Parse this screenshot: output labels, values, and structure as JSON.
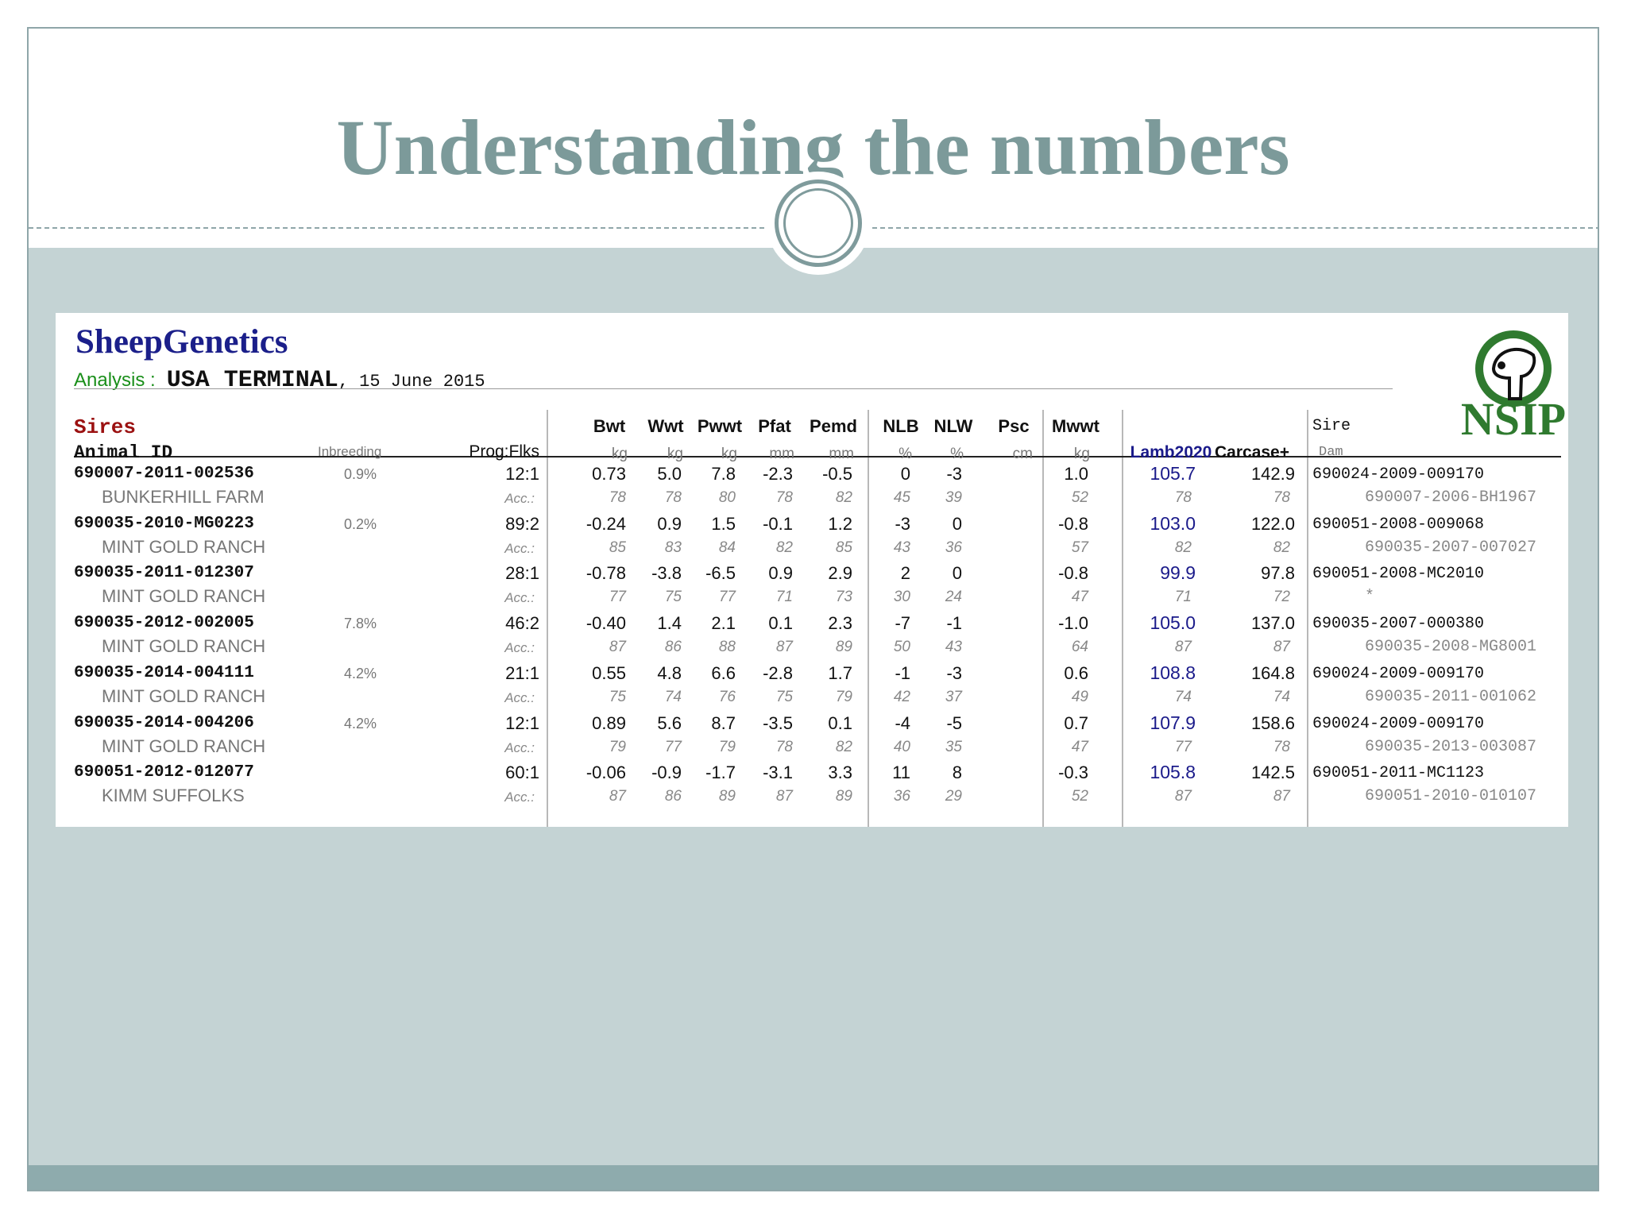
{
  "slide": {
    "title": "Understanding the numbers"
  },
  "report": {
    "brand": "SheepGenetics",
    "analysis_label": "Analysis :",
    "analysis_name": "USA TERMINAL",
    "analysis_date": ", 15 June 2015",
    "logo_text": "NSIP",
    "section_label": "Sires",
    "col_animal": "Animal ID",
    "col_inbreeding": "Inbreeding",
    "col_prog": "Prog:Flks",
    "traits": [
      {
        "name": "Bwt",
        "unit": "kg"
      },
      {
        "name": "Wwt",
        "unit": "kg"
      },
      {
        "name": "Pwwt",
        "unit": "kg"
      },
      {
        "name": "Pfat",
        "unit": "mm"
      },
      {
        "name": "Pemd",
        "unit": "mm"
      },
      {
        "name": "NLB",
        "unit": "%"
      },
      {
        "name": "NLW",
        "unit": "%"
      },
      {
        "name": "Psc",
        "unit": "cm"
      },
      {
        "name": "Mwwt",
        "unit": "kg"
      }
    ],
    "col_lamb": "Lamb2020",
    "col_carcase": "Carcase+",
    "col_sire": "Sire",
    "col_dam": "Dam",
    "acc_label": "Acc.:",
    "rows": [
      {
        "id": "690007-2011-002536",
        "farm": "BUNKERHILL FARM",
        "inbreeding": "0.9%",
        "prog": "12:1",
        "values": [
          "0.73",
          "5.0",
          "7.8",
          "-2.3",
          "-0.5",
          "0",
          "-3",
          "",
          "1.0"
        ],
        "acc": [
          "78",
          "78",
          "80",
          "78",
          "82",
          "45",
          "39",
          "",
          "52"
        ],
        "lamb": "105.7",
        "carcase": "142.9",
        "lamb_acc": "78",
        "carcase_acc": "78",
        "sire": "690024-2009-009170",
        "dam": "690007-2006-BH1967"
      },
      {
        "id": "690035-2010-MG0223",
        "farm": "MINT GOLD RANCH",
        "inbreeding": "0.2%",
        "prog": "89:2",
        "values": [
          "-0.24",
          "0.9",
          "1.5",
          "-0.1",
          "1.2",
          "-3",
          "0",
          "",
          "-0.8"
        ],
        "acc": [
          "85",
          "83",
          "84",
          "82",
          "85",
          "43",
          "36",
          "",
          "57"
        ],
        "lamb": "103.0",
        "carcase": "122.0",
        "lamb_acc": "82",
        "carcase_acc": "82",
        "sire": "690051-2008-009068",
        "dam": "690035-2007-007027"
      },
      {
        "id": "690035-2011-012307",
        "farm": "MINT GOLD RANCH",
        "inbreeding": "",
        "prog": "28:1",
        "values": [
          "-0.78",
          "-3.8",
          "-6.5",
          "0.9",
          "2.9",
          "2",
          "0",
          "",
          "-0.8"
        ],
        "acc": [
          "77",
          "75",
          "77",
          "71",
          "73",
          "30",
          "24",
          "",
          "47"
        ],
        "lamb": "99.9",
        "carcase": "97.8",
        "lamb_acc": "71",
        "carcase_acc": "72",
        "sire": "690051-2008-MC2010",
        "dam": "*"
      },
      {
        "id": "690035-2012-002005",
        "farm": "MINT GOLD RANCH",
        "inbreeding": "7.8%",
        "prog": "46:2",
        "values": [
          "-0.40",
          "1.4",
          "2.1",
          "0.1",
          "2.3",
          "-7",
          "-1",
          "",
          "-1.0"
        ],
        "acc": [
          "87",
          "86",
          "88",
          "87",
          "89",
          "50",
          "43",
          "",
          "64"
        ],
        "lamb": "105.0",
        "carcase": "137.0",
        "lamb_acc": "87",
        "carcase_acc": "87",
        "sire": "690035-2007-000380",
        "dam": "690035-2008-MG8001"
      },
      {
        "id": "690035-2014-004111",
        "farm": "MINT GOLD RANCH",
        "inbreeding": "4.2%",
        "prog": "21:1",
        "values": [
          "0.55",
          "4.8",
          "6.6",
          "-2.8",
          "1.7",
          "-1",
          "-3",
          "",
          "0.6"
        ],
        "acc": [
          "75",
          "74",
          "76",
          "75",
          "79",
          "42",
          "37",
          "",
          "49"
        ],
        "lamb": "108.8",
        "carcase": "164.8",
        "lamb_acc": "74",
        "carcase_acc": "74",
        "sire": "690024-2009-009170",
        "dam": "690035-2011-001062"
      },
      {
        "id": "690035-2014-004206",
        "farm": "MINT GOLD RANCH",
        "inbreeding": "4.2%",
        "prog": "12:1",
        "values": [
          "0.89",
          "5.6",
          "8.7",
          "-3.5",
          "0.1",
          "-4",
          "-5",
          "",
          "0.7"
        ],
        "acc": [
          "79",
          "77",
          "79",
          "78",
          "82",
          "40",
          "35",
          "",
          "47"
        ],
        "lamb": "107.9",
        "carcase": "158.6",
        "lamb_acc": "77",
        "carcase_acc": "78",
        "sire": "690024-2009-009170",
        "dam": "690035-2013-003087"
      },
      {
        "id": "690051-2012-012077",
        "farm": "KIMM SUFFOLKS",
        "inbreeding": "",
        "prog": "60:1",
        "values": [
          "-0.06",
          "-0.9",
          "-1.7",
          "-3.1",
          "3.3",
          "11",
          "8",
          "",
          "-0.3"
        ],
        "acc": [
          "87",
          "86",
          "89",
          "87",
          "89",
          "36",
          "29",
          "",
          "52"
        ],
        "lamb": "105.8",
        "carcase": "142.5",
        "lamb_acc": "87",
        "carcase_acc": "87",
        "sire": "690051-2011-MC1123",
        "dam": "690051-2010-010107"
      }
    ]
  }
}
